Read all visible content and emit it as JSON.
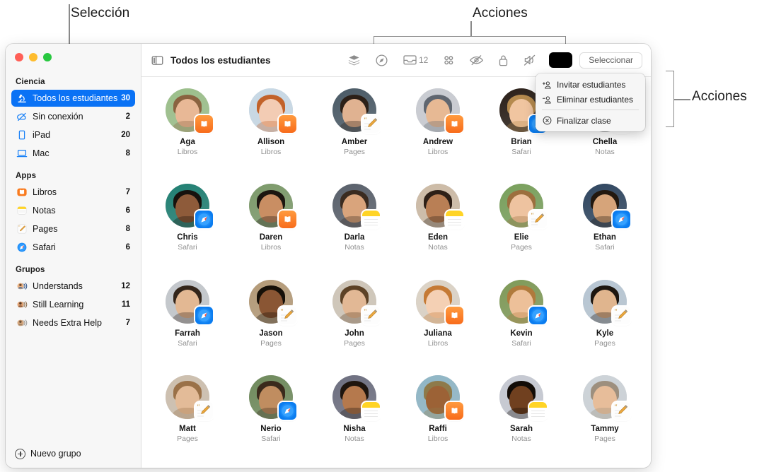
{
  "annotations": [
    {
      "id": "seleccion",
      "label": "Selección"
    },
    {
      "id": "acciones-top",
      "label": "Acciones"
    },
    {
      "id": "acciones-right",
      "label": "Acciones"
    }
  ],
  "window": {
    "traffic_lights": [
      "close",
      "minimize",
      "zoom"
    ]
  },
  "sidebar": {
    "sections": [
      {
        "title": "Ciencia",
        "items": [
          {
            "icon": "microscope-icon",
            "label": "Todos los estudiantes",
            "count": "30",
            "selected": true
          },
          {
            "icon": "cloud-slash-icon",
            "label": "Sin conexión",
            "count": "2",
            "selected": false
          },
          {
            "icon": "ipad-icon",
            "label": "iPad",
            "count": "20",
            "selected": false
          },
          {
            "icon": "mac-icon",
            "label": "Mac",
            "count": "8",
            "selected": false
          }
        ]
      },
      {
        "title": "Apps",
        "items": [
          {
            "icon": "books-app-icon",
            "label": "Libros",
            "count": "7",
            "selected": false
          },
          {
            "icon": "notes-app-icon",
            "label": "Notas",
            "count": "6",
            "selected": false
          },
          {
            "icon": "pages-app-icon",
            "label": "Pages",
            "count": "8",
            "selected": false
          },
          {
            "icon": "safari-app-icon",
            "label": "Safari",
            "count": "6",
            "selected": false
          }
        ]
      },
      {
        "title": "Grupos",
        "items": [
          {
            "icon": "group-avatars-icon",
            "label": "Understands",
            "count": "12",
            "selected": false
          },
          {
            "icon": "group-avatars-icon",
            "label": "Still Learning",
            "count": "11",
            "selected": false
          },
          {
            "icon": "group-avatars-icon",
            "label": "Needs Extra Help",
            "count": "7",
            "selected": false
          }
        ]
      }
    ],
    "footer": {
      "icon": "plus-circle-icon",
      "label": "Nuevo grupo"
    }
  },
  "toolbar": {
    "sidebar_toggle_icon": "sidebar-toggle-icon",
    "title": "Todos los estudiantes",
    "icons": [
      {
        "name": "layers-icon"
      },
      {
        "name": "navigate-compass-icon"
      },
      {
        "name": "inbox-tray-icon",
        "badge": "12"
      },
      {
        "name": "apps-grid-icon"
      },
      {
        "name": "eye-slash-icon"
      },
      {
        "name": "lock-icon"
      },
      {
        "name": "mute-speaker-icon"
      }
    ],
    "color_swatch": "#000000",
    "select_label": "Seleccionar"
  },
  "popup_menu": {
    "items": [
      {
        "icon": "person-add-icon",
        "label": "Invitar estudiantes",
        "separator_after": false
      },
      {
        "icon": "person-remove-icon",
        "label": "Eliminar estudiantes",
        "separator_after": true
      },
      {
        "icon": "x-circle-icon",
        "label": "Finalizar clase",
        "separator_after": false
      }
    ]
  },
  "students": [
    {
      "name": "Aga",
      "app": "Libros",
      "badge": "books",
      "skin": "#e8b896",
      "hair": "#8a6340",
      "bg": "#9bbf8a"
    },
    {
      "name": "Allison",
      "app": "Libros",
      "badge": "books",
      "skin": "#f3ccb4",
      "hair": "#c2622a",
      "bg": "#c8d9e6"
    },
    {
      "name": "Amber",
      "app": "Pages",
      "badge": "pages",
      "skin": "#e0b291",
      "hair": "#2c2018",
      "bg": "#4a5a66"
    },
    {
      "name": "Andrew",
      "app": "Libros",
      "badge": "books",
      "skin": "#e7b994",
      "hair": "#5f6670",
      "bg": "#c9ccd2"
    },
    {
      "name": "Brian",
      "app": "Safari",
      "badge": "safari",
      "skin": "#f0c5a0",
      "hair": "#b58a4e",
      "bg": "#2a1f18"
    },
    {
      "name": "Chella",
      "app": "Notas",
      "badge": "notes",
      "skin": "#d8a074",
      "hair": "#2b2119",
      "bg": "#b9c3cb"
    },
    {
      "name": "Chris",
      "app": "Safari",
      "badge": "safari",
      "skin": "#8e5b3a",
      "hair": "#17120d",
      "bg": "#1f7f72"
    },
    {
      "name": "Daren",
      "app": "Libros",
      "badge": "books",
      "skin": "#c98e63",
      "hair": "#1c1610",
      "bg": "#7c9a6a"
    },
    {
      "name": "Darla",
      "app": "Notas",
      "badge": "notes",
      "skin": "#d9a47c",
      "hair": "#3a2b20",
      "bg": "#59606b"
    },
    {
      "name": "Eden",
      "app": "Notas",
      "badge": "notes",
      "skin": "#b97f55",
      "hair": "#2e2017",
      "bg": "#cdbba6"
    },
    {
      "name": "Elie",
      "app": "Pages",
      "badge": "pages",
      "skin": "#eec3a0",
      "hair": "#9c6f3e",
      "bg": "#79a05c"
    },
    {
      "name": "Ethan",
      "app": "Safari",
      "badge": "safari",
      "skin": "#d6a47a",
      "hair": "#22180f",
      "bg": "#2f4660"
    },
    {
      "name": "Farrah",
      "app": "Safari",
      "badge": "safari",
      "skin": "#e3b893",
      "hair": "#33251a",
      "bg": "#c3c7cc"
    },
    {
      "name": "Jason",
      "app": "Pages",
      "badge": "pages",
      "skin": "#8a5634",
      "hair": "#161008",
      "bg": "#b49a77"
    },
    {
      "name": "John",
      "app": "Pages",
      "badge": "pages",
      "skin": "#e2b895",
      "hair": "#5d4226",
      "bg": "#cfc6b8"
    },
    {
      "name": "Juliana",
      "app": "Libros",
      "badge": "books",
      "skin": "#f4d0b4",
      "hair": "#c57a35",
      "bg": "#dcd3c6"
    },
    {
      "name": "Kevin",
      "app": "Safari",
      "badge": "safari",
      "skin": "#edc099",
      "hair": "#b07a3c",
      "bg": "#7f9a58"
    },
    {
      "name": "Kyle",
      "app": "Pages",
      "badge": "pages",
      "skin": "#e0b58e",
      "hair": "#1d1610",
      "bg": "#b7c6d3"
    },
    {
      "name": "Matt",
      "app": "Pages",
      "badge": "pages",
      "skin": "#e3bb98",
      "hair": "#9a7148",
      "bg": "#cdbfae"
    },
    {
      "name": "Nerio",
      "app": "Safari",
      "badge": "safari",
      "skin": "#c08d60",
      "hair": "#3a2a1c",
      "bg": "#6f8a5c"
    },
    {
      "name": "Nisha",
      "app": "Notas",
      "badge": "notes",
      "skin": "#b5794d",
      "hair": "#1e150e",
      "bg": "#6d6f80"
    },
    {
      "name": "Raffi",
      "app": "Libros",
      "badge": "books",
      "skin": "#9c6236",
      "hair": "#8e7a4a",
      "bg": "#8fb6c6"
    },
    {
      "name": "Sarah",
      "app": "Notas",
      "badge": "notes",
      "skin": "#70401f",
      "hair": "#120c07",
      "bg": "#c6c9d2"
    },
    {
      "name": "Tammy",
      "app": "Pages",
      "badge": "pages",
      "skin": "#e7bd9a",
      "hair": "#9d8f7e",
      "bg": "#cdd3d8"
    }
  ]
}
